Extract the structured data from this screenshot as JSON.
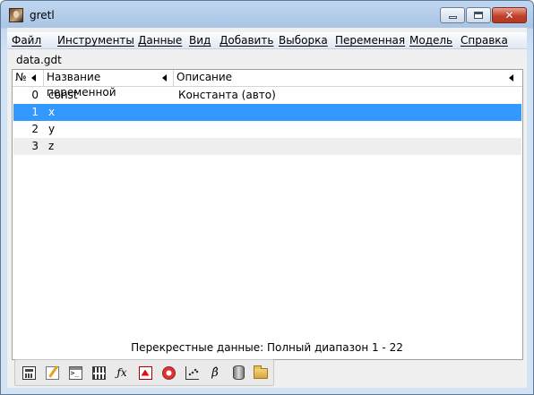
{
  "window": {
    "title": "gretl"
  },
  "menu": {
    "items": [
      {
        "label": "Файл"
      },
      {
        "label": "Инструменты"
      },
      {
        "label": "Данные"
      },
      {
        "label": "Вид"
      },
      {
        "label": "Добавить"
      },
      {
        "label": "Выборка"
      },
      {
        "label": "Переменная"
      },
      {
        "label": "Модель"
      },
      {
        "label": "Справка"
      }
    ]
  },
  "dataset": {
    "filename": "data.gdt"
  },
  "table": {
    "columns": {
      "num": "№",
      "name": "Название переменной",
      "desc": "Описание"
    },
    "rows": [
      {
        "num": "0",
        "name": "const",
        "desc": "Константа (авто)"
      },
      {
        "num": "1",
        "name": "x",
        "desc": ""
      },
      {
        "num": "2",
        "name": "y",
        "desc": ""
      },
      {
        "num": "3",
        "name": "z",
        "desc": ""
      }
    ],
    "selected_row": 1,
    "selected_color": "#3399ff"
  },
  "status": {
    "text": "Перекрестные данные: Полный диапазон 1 - 22"
  },
  "toolbar": {
    "icons": [
      "calculator-icon",
      "edit-icon",
      "terminal-icon",
      "session-grid-icon",
      "function-icon",
      "pdf-icon",
      "help-icon",
      "scatter-plot-icon",
      "beta-icon",
      "database-icon",
      "folder-icon"
    ]
  },
  "colors": {
    "close_button": "#c3412a",
    "selection": "#3399ff"
  }
}
